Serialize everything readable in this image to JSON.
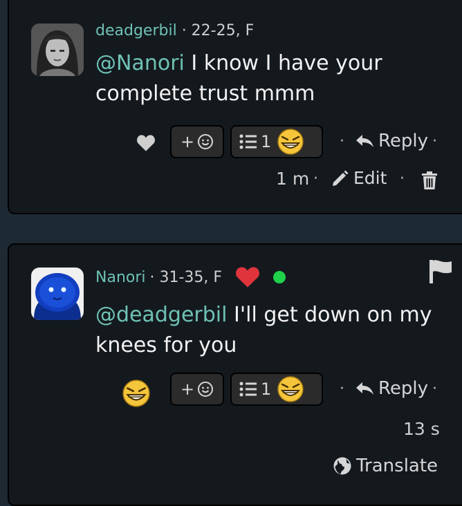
{
  "comments": [
    {
      "username": "deadgerbil",
      "meta_suffix": "· 22-25, F",
      "mention": "@Nanori",
      "text": " I know I have your complete trust mmm",
      "add_reaction_label": "+",
      "reaction_count": "1",
      "reply_label": "Reply",
      "time": "1 m",
      "edit_label": "Edit",
      "dot": "·"
    },
    {
      "username": "Nanori",
      "meta_suffix": "· 31-35, F",
      "mention": "@deadgerbil",
      "text": " I'll get down on my knees for you",
      "add_reaction_label": "+",
      "reaction_count": "1",
      "reply_label": "Reply",
      "time": "13 s",
      "translate_label": "Translate",
      "dot": "·"
    }
  ],
  "colors": {
    "background": "#1e2a33",
    "card": "#14191e",
    "username": "#6fc2b5",
    "online": "#1fd24a",
    "heart_red": "#e0343c",
    "emoji_yellow": "#f5c63b"
  }
}
